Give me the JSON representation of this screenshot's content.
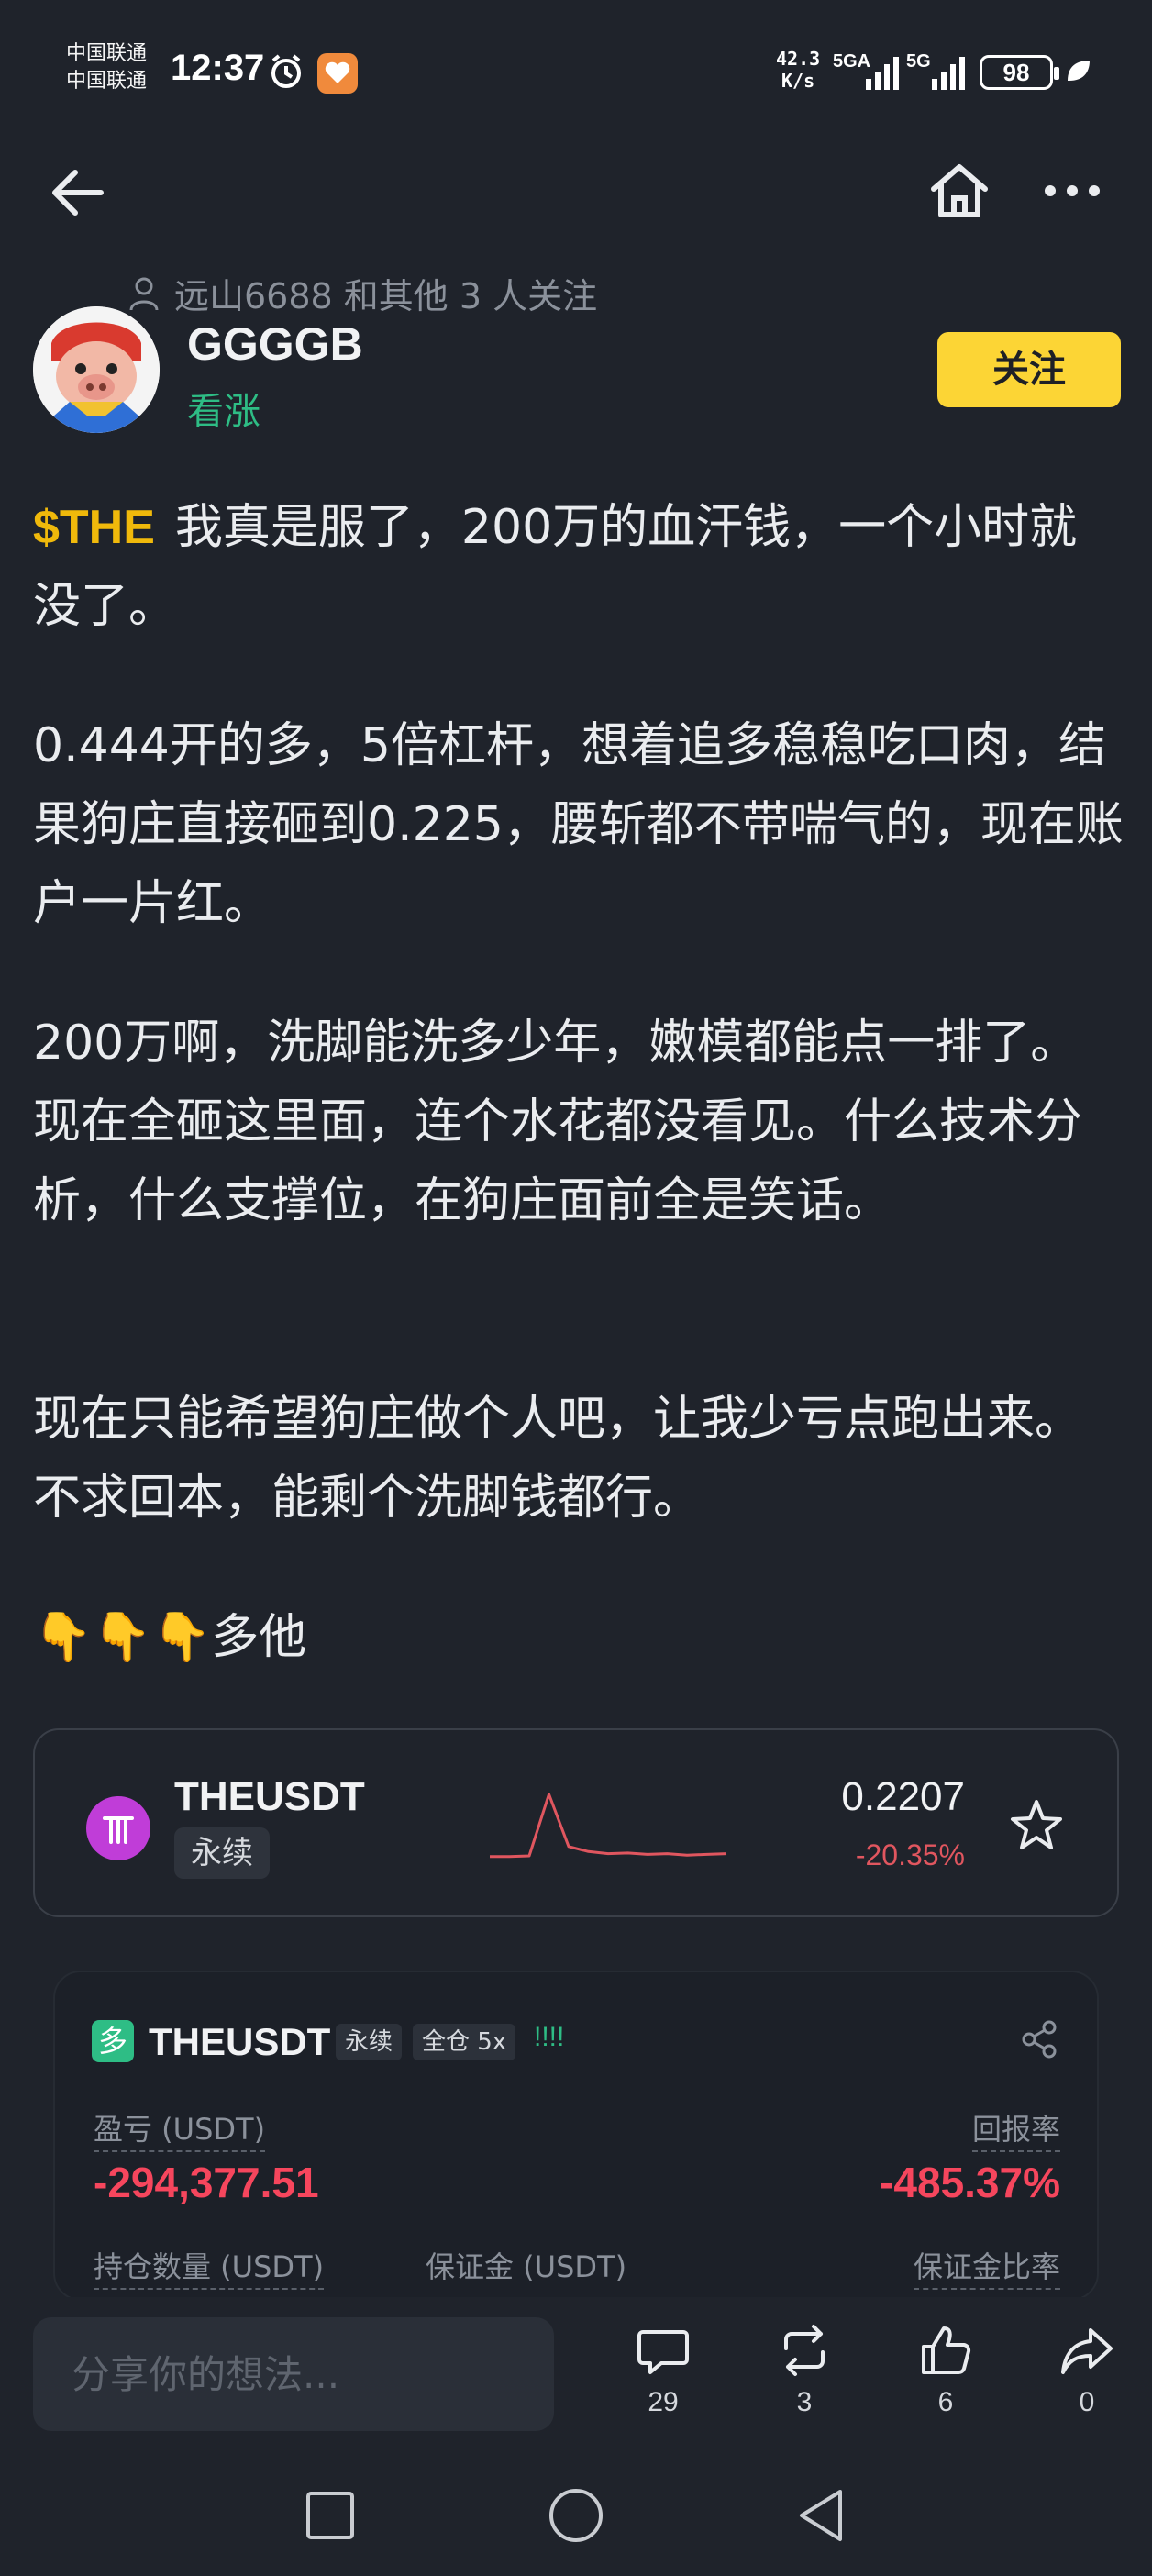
{
  "status_bar": {
    "carrier_1": "中国联通",
    "carrier_2": "中国联通",
    "time": "12:37",
    "speed_value": "42.3",
    "speed_unit": "K/s",
    "net_1": "5GA",
    "net_2": "5G",
    "battery": "98"
  },
  "author": {
    "followers_text": "远山6688 和其他 3 人关注",
    "name": "GGGGB",
    "sentiment": "看涨",
    "follow_label": "关注"
  },
  "post": {
    "tag": "$THE",
    "p1": "我真是服了，200万的血汗钱，一个小时就没了。",
    "p2": "0.444开的多，5倍杠杆，想着追多稳稳吃口肉，结果狗庄直接砸到0.225，腰斩都不带喘气的，现在账户一片红。",
    "p3": "200万啊，洗脚能洗多少年，嫩模都能点一排了。现在全砸这里面，连个水花都没看见。什么技术分析，什么支撑位，在狗庄面前全是笑话。",
    "p4": "现在只能希望狗庄做个人吧，让我少亏点跑出来。不求回本，能剩个洗脚钱都行。",
    "p5": "👇👇👇多他"
  },
  "market_card": {
    "symbol": "THEUSDT",
    "tag": "永续",
    "price": "0.2207",
    "change": "-20.35%",
    "sparkline": [
      0.08,
      0.08,
      0.09,
      0.95,
      0.22,
      0.15,
      0.12,
      0.13,
      0.11,
      0.12,
      0.1,
      0.11,
      0.12
    ],
    "colors": {
      "logo": "#c03dd8",
      "down": "#e0565f"
    }
  },
  "pnl_card": {
    "side": "多",
    "symbol": "THEUSDT",
    "type": "永续",
    "margin": "全仓 5x",
    "flag": "!!!!",
    "pnl_label": "盈亏 (USDT)",
    "pnl_value": "-294,377.51",
    "roe_label": "回报率",
    "roe_value": "-485.37%",
    "size_label": "持仓数量 (USDT)",
    "margin_label": "保证金 (USDT)",
    "margin_ratio_label": "保证金比率"
  },
  "bottom_bar": {
    "input_placeholder": "分享你的想法...",
    "comments": "29",
    "reposts": "3",
    "likes": "6",
    "shares": "0"
  }
}
